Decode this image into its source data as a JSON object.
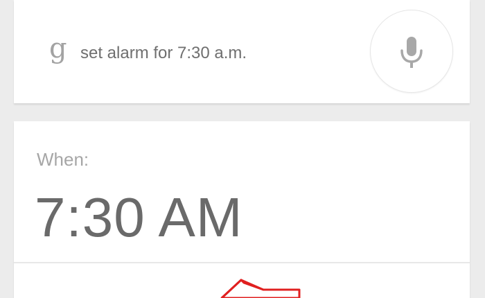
{
  "search": {
    "logo": "g",
    "query": "set alarm for 7:30 a.m.",
    "mic_icon": "microphone-icon"
  },
  "alarm": {
    "when_label": "When:",
    "time": "7:30 AM"
  },
  "colors": {
    "background": "#ececec",
    "card": "#ffffff",
    "annotation_arrow": "#e02020"
  }
}
